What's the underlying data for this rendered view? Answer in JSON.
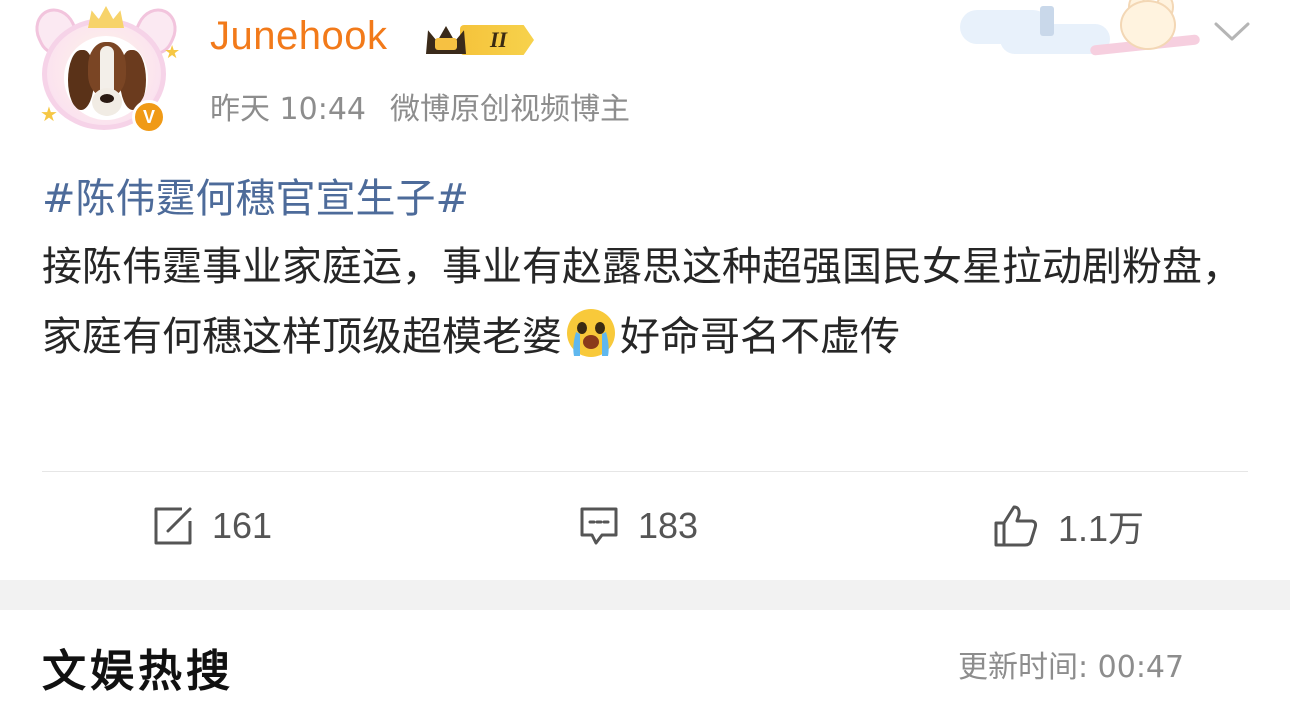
{
  "post": {
    "username": "Junehook",
    "vip_level": "II",
    "verified_badge": "V",
    "time": "昨天 10:44",
    "source": "微博原创视频博主",
    "hashtag": "#陈伟霆何穗官宣生子#",
    "body_before_emoji": "接陈伟霆事业家庭运，事业有赵露思这种超强国民女星拉动剧粉盘，家庭有何穗这样顶级超模老婆",
    "emoji": "crying-face-emoji",
    "body_after_emoji": "好命哥名不虚传",
    "actions": {
      "repost_count": "161",
      "comment_count": "183",
      "like_count": "1.1万"
    }
  },
  "section": {
    "title": "文娱热搜",
    "update_time": "更新时间: 00:47"
  },
  "colors": {
    "username": "#f27a1a",
    "hashtag": "#4d6b9a",
    "meta": "#8d8d8d",
    "text": "#262626",
    "verified": "#f09a16"
  }
}
